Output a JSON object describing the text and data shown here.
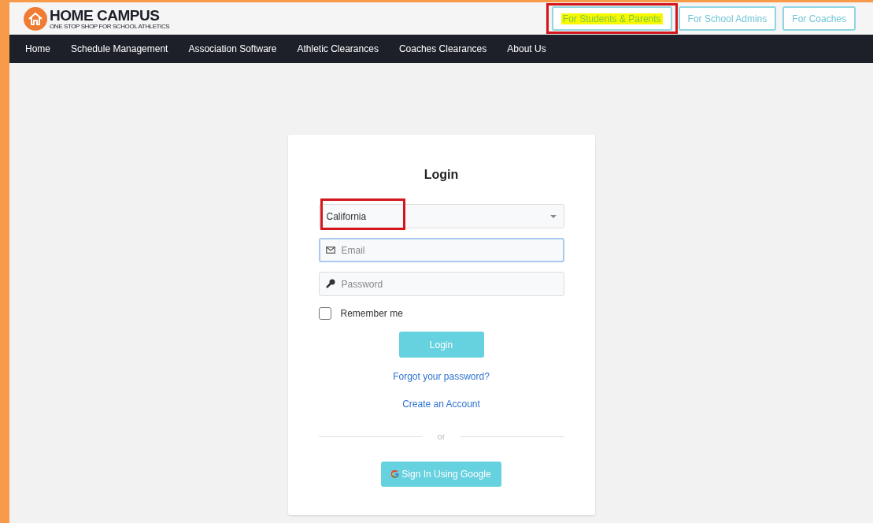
{
  "brand": {
    "name": "HOME CAMPUS",
    "tagline": "ONE STOP SHOP FOR SCHOOL ATHLETICS"
  },
  "audience_links": [
    {
      "label": "For Students & Parents",
      "highlighted": true
    },
    {
      "label": "For School Admins",
      "highlighted": false
    },
    {
      "label": "For Coaches",
      "highlighted": false
    }
  ],
  "nav": [
    "Home",
    "Schedule Management",
    "Association Software",
    "Athletic Clearances",
    "Coaches Clearances",
    "About Us"
  ],
  "login": {
    "title": "Login",
    "state_select": {
      "value": "California",
      "outlined": true
    },
    "email": {
      "placeholder": "Email",
      "focused": true
    },
    "password": {
      "placeholder": "Password",
      "focused": false
    },
    "remember": {
      "label": "Remember me",
      "checked": false
    },
    "submit": "Login",
    "forgot": "Forgot your password?",
    "create": "Create an Account",
    "divider": "or",
    "google": "Sign In Using Google"
  }
}
